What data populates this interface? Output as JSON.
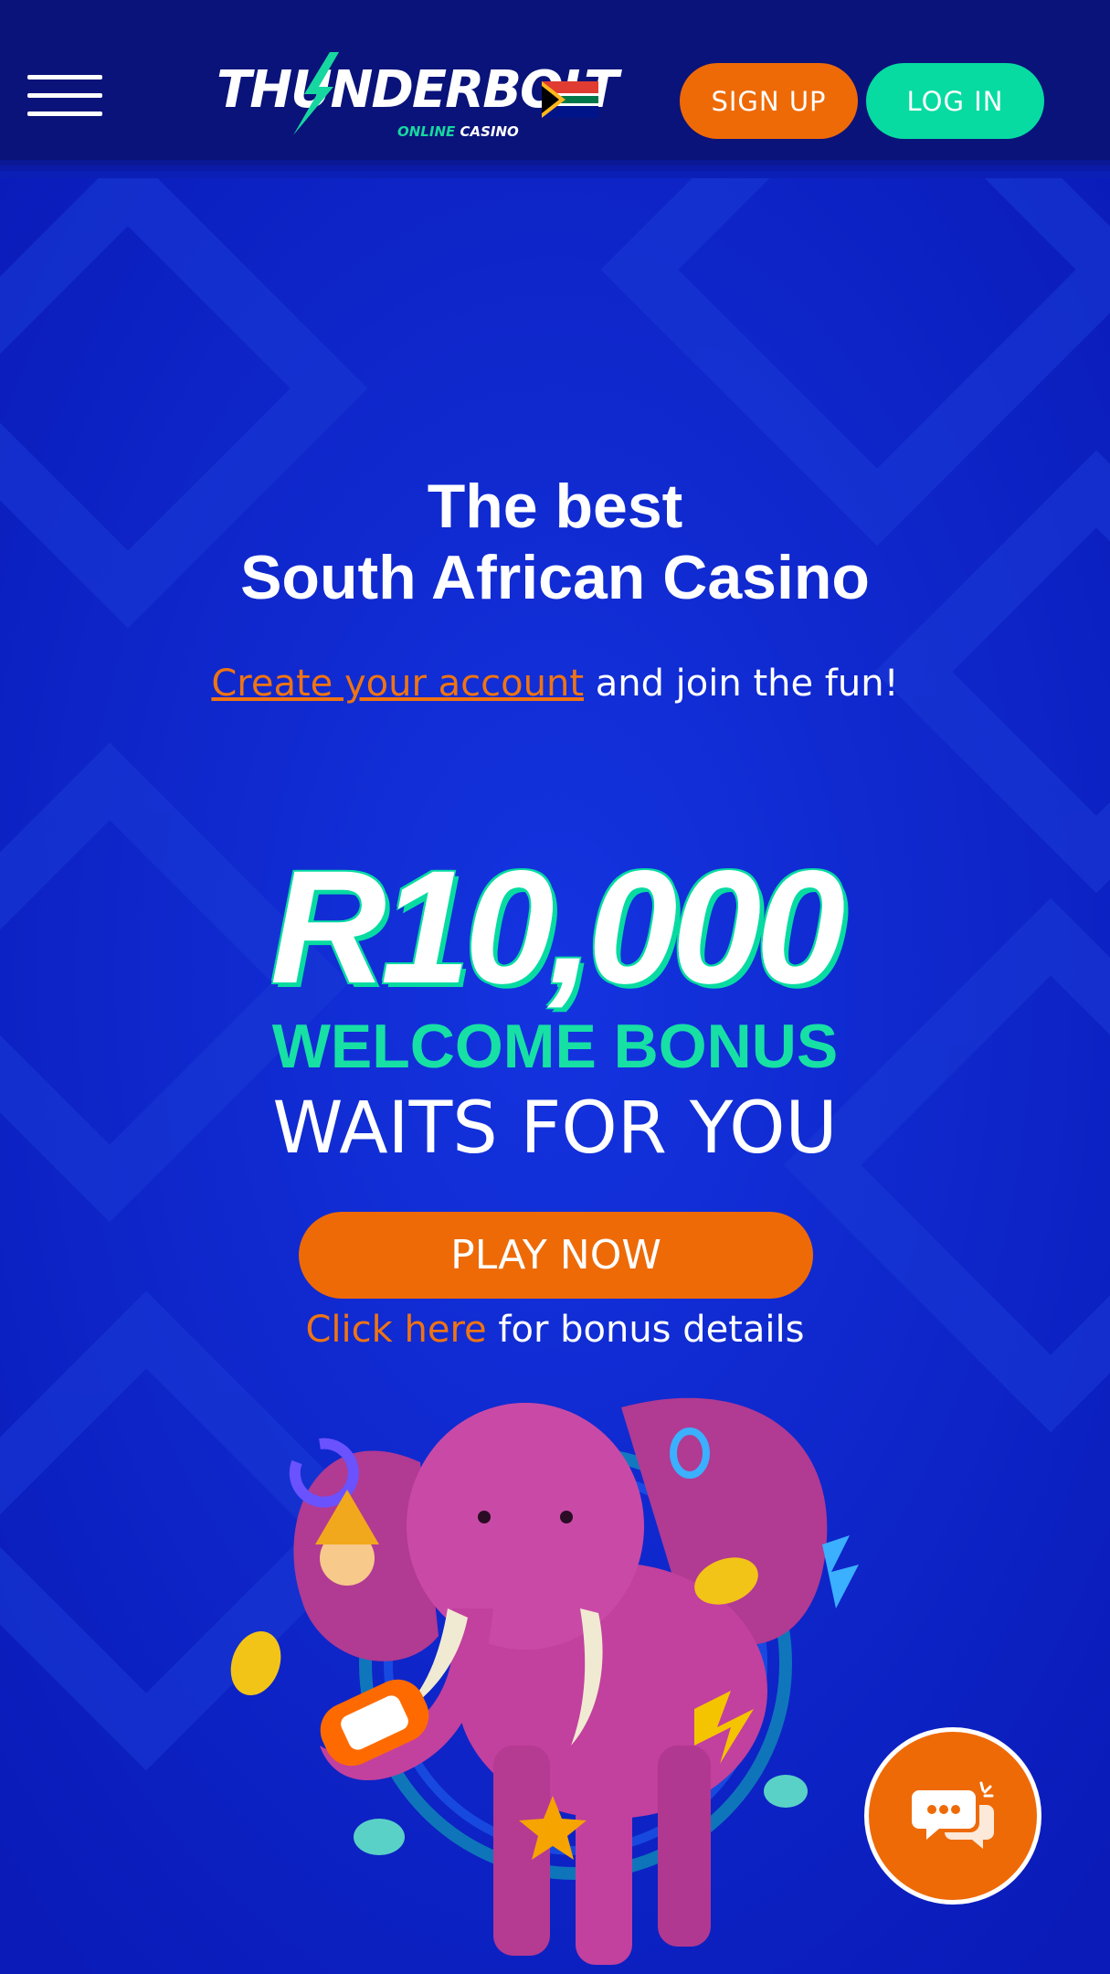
{
  "header": {
    "logo": {
      "main": "THUNDERBOLT",
      "sub_online": "ONLINE",
      "sub_casino": "CASINO"
    },
    "menu_icon": "hamburger-menu-icon",
    "signup_label": "SIGN UP",
    "login_label": "LOG IN"
  },
  "hero": {
    "headline_line1": "The best",
    "headline_line2": "South African Casino",
    "create_link": "Create your account",
    "create_suffix": " and join the fun!",
    "bonus_amount": "R10,000",
    "bonus_line1": "WELCOME BONUS",
    "bonus_line2": "WAITS FOR YOU",
    "play_label": "PLAY NOW",
    "details_link": "Click here",
    "details_suffix": " for bonus details"
  },
  "chat": {
    "icon": "chat-bubbles-icon"
  },
  "colors": {
    "header_bg": "#0a137a",
    "page_bg": "#0b1fc4",
    "accent_orange": "#ee6a07",
    "accent_green": "#07dba2",
    "bonus_green": "#17e0a5",
    "elephant_pink": "#c2409e"
  }
}
